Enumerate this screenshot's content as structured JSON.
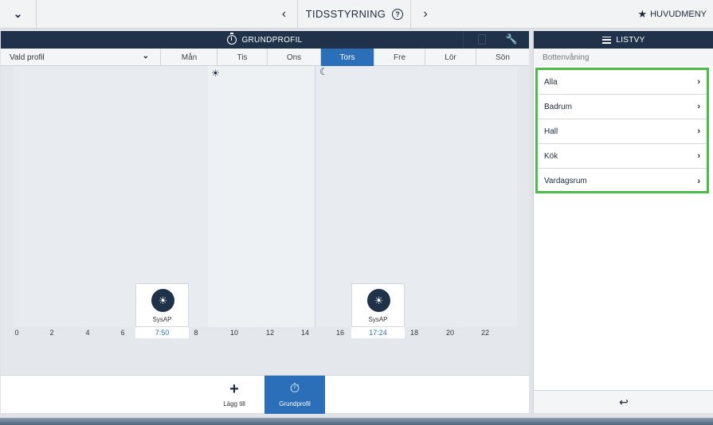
{
  "topbar": {
    "title": "TIDSSTYRNING",
    "help": "?",
    "prev": "‹",
    "next": "›",
    "menu_chevron": "⌄",
    "main_menu": "HUVUDMENY"
  },
  "schedule": {
    "header": "GRUNDPROFIL",
    "profile_select": "Vald profil",
    "days": [
      "Mån",
      "Tis",
      "Ons",
      "Tors",
      "Fre",
      "Lör",
      "Sön"
    ],
    "active_day": "Tors",
    "hours": [
      "0",
      "2",
      "4",
      "6",
      "8",
      "10",
      "12",
      "14",
      "16",
      "18",
      "20",
      "22"
    ],
    "events": [
      {
        "label": "SysAP",
        "time": "7:50",
        "icon": "sun-icon"
      },
      {
        "label": "SysAP",
        "time": "17:24",
        "icon": "sun-icon"
      }
    ],
    "bottom": {
      "add_label": "Lägg till",
      "profile_label": "Grundprofil"
    }
  },
  "list_view": {
    "header": "LISTVY",
    "floor": "Bottenvåning",
    "rooms": [
      "Alla",
      "Badrum",
      "Hall",
      "Kök",
      "Vardagsrum"
    ]
  },
  "colors": {
    "header_bg": "#1f3249",
    "accent": "#2a6fb8",
    "highlight": "#4cbb4a"
  }
}
